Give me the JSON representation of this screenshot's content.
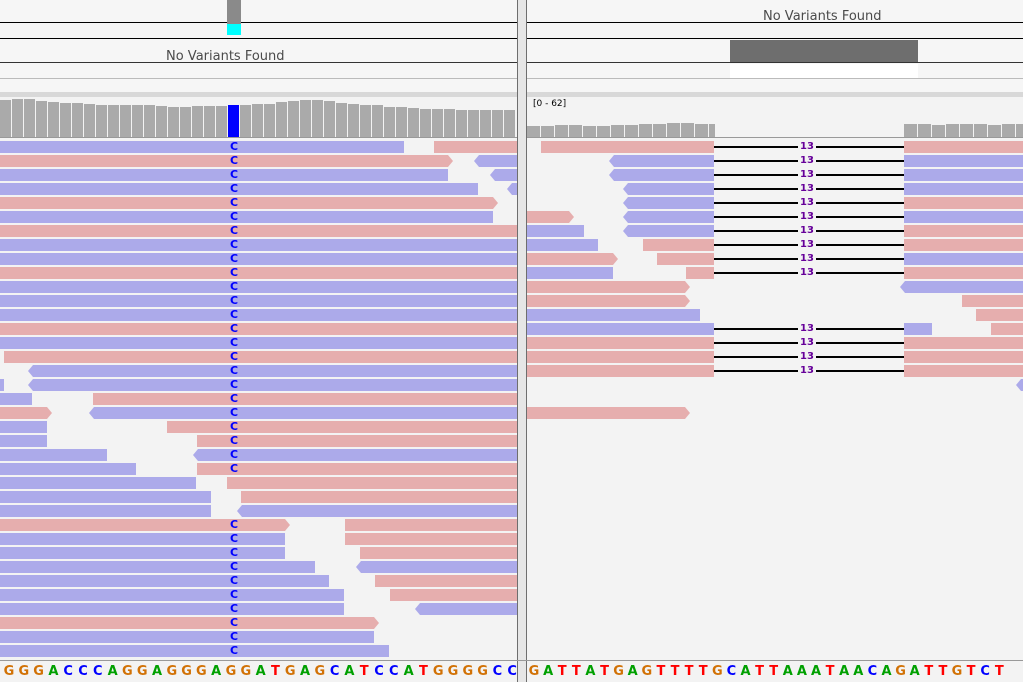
{
  "variant_track": {
    "left_message": "No Variants Found",
    "right_message": "No Variants Found"
  },
  "coverage": {
    "right_range_label": "[0 - 62]",
    "highlight_base": "C"
  },
  "mismatch_base": "C",
  "junction_gap_label": "13",
  "sequence": {
    "left": "GGGACCCAGGAGGGAGGATGAGCATCCATGGGGCC",
    "right": "GATTATGAGTTTTGCATTAAATAACAGATTGTCT"
  },
  "colors": {
    "forward_read": "#e6aeae",
    "reverse_read": "#acaaea",
    "coverage": "#aaaaaa",
    "mismatch_C": "#0000ff",
    "base_A": "#00a000",
    "base_C": "#0000ff",
    "base_G": "#d17105",
    "base_T": "#ff0000",
    "gap_label": "#660099"
  }
}
